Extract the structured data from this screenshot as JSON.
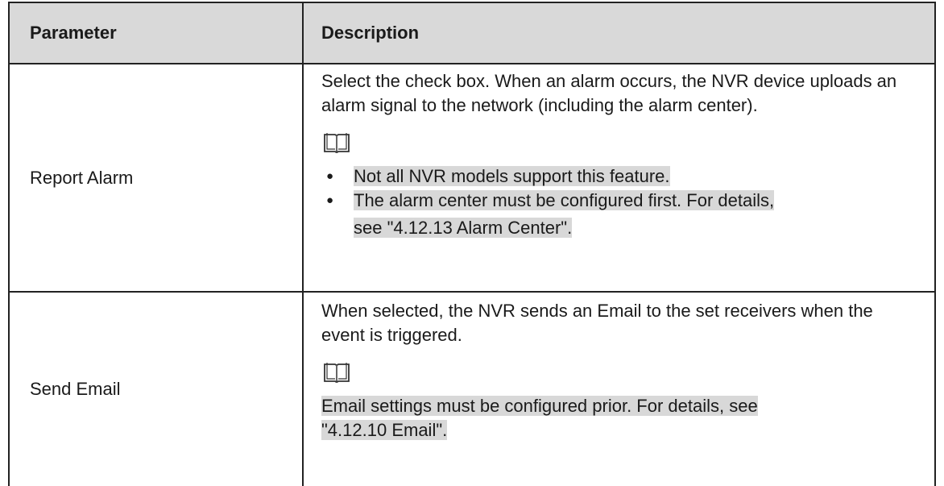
{
  "table": {
    "headers": {
      "parameter": "Parameter",
      "description": "Description"
    },
    "rows": [
      {
        "parameter": "Report Alarm",
        "description": "Select the check box. When an alarm occurs, the NVR device uploads an alarm signal to the network (including the alarm center).",
        "note_icon": "book-note-icon",
        "bullets": [
          "Not all NVR models support this feature.",
          "The alarm center must be configured first. For details,"
        ],
        "see_prefix": "see ",
        "see_link": "\"4.12.13 Alarm Center\".",
        "see_suffix": ""
      },
      {
        "parameter": "Send Email",
        "description": "When selected, the NVR sends an Email to the set receivers when the event is triggered.",
        "note_icon": "book-note-icon",
        "note_text_line1": "Email settings must be configured prior. For details, see",
        "note_text_line2": "\"4.12.10 Email\"."
      }
    ]
  }
}
